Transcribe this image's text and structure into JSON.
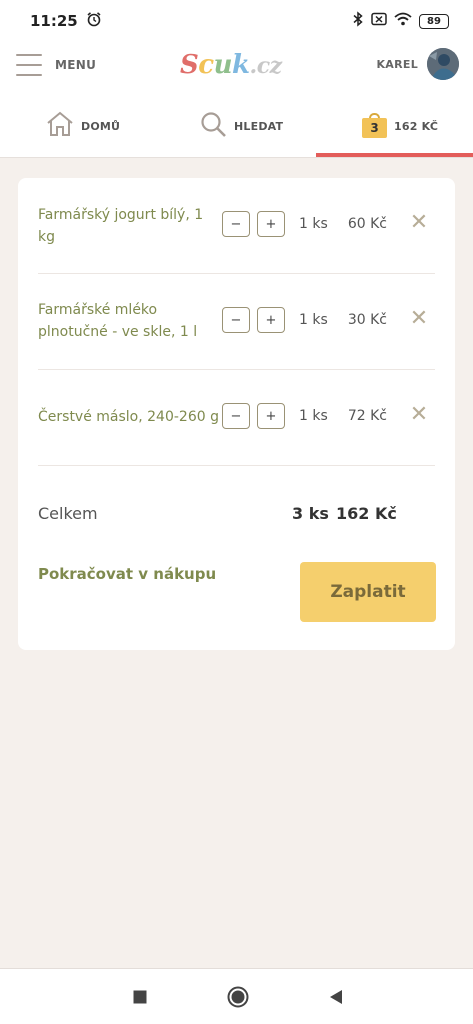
{
  "status_bar": {
    "time": "11:25",
    "battery": "89"
  },
  "header": {
    "menu_label": "MENU",
    "logo": {
      "part1": "S",
      "part2": "c",
      "part3": "u",
      "part4": "k",
      "part5": ".cz"
    },
    "user_name": "KAREL"
  },
  "tabs": {
    "home_label": "DOMŮ",
    "search_label": "HLEDAT",
    "cart_count": "3",
    "cart_total": "162 KČ"
  },
  "cart": {
    "items": [
      {
        "name": "Farmářský jogurt bílý, 1 kg",
        "qty": "1 ks",
        "price": "60 Kč"
      },
      {
        "name": "Farmářské mléko plnotučné - ve skle, 1 l",
        "qty": "1 ks",
        "price": "30 Kč"
      },
      {
        "name": "Čerstvé máslo, 240-260 g",
        "qty": "1 ks",
        "price": "72 Kč"
      }
    ],
    "minus_label": "−",
    "plus_label": "+",
    "remove_label": "✕",
    "summary_label": "Celkem",
    "summary_qty": "3 ks",
    "summary_price": "162 Kč",
    "continue_label": "Pokračovat v nákupu",
    "pay_label": "Zaplatit"
  },
  "colors": {
    "accent_red": "#e35d5a",
    "pay_yellow": "#f5cf6d",
    "olive_text": "#7f8a4e",
    "background": "#f5f0ec"
  }
}
